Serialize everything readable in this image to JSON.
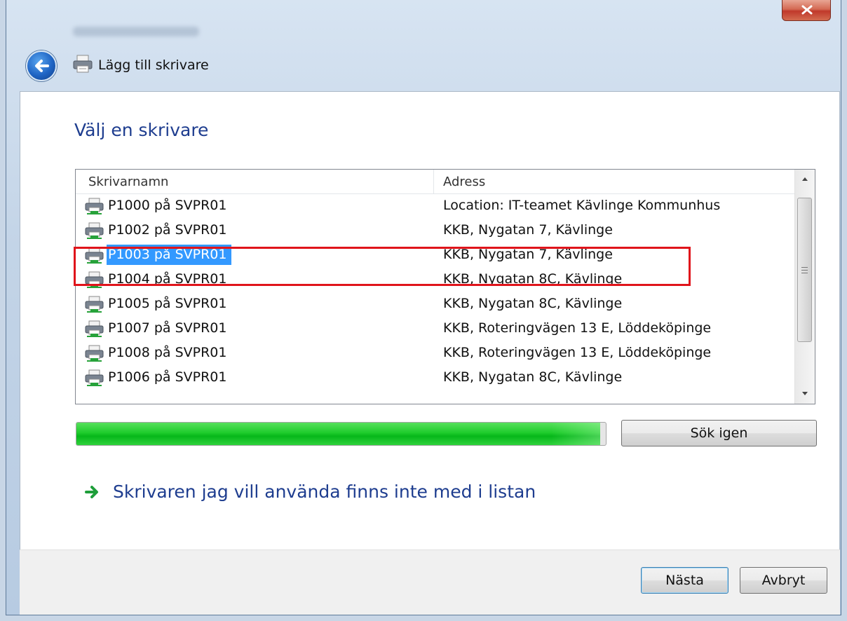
{
  "window": {
    "title": "Lägg till skrivare",
    "close_label": "x"
  },
  "content": {
    "heading": "Välj en skrivare"
  },
  "printer_list": {
    "column_name": "Skrivarnamn",
    "column_address": "Adress",
    "rows": [
      {
        "name": "P1000 på SVPR01",
        "address": "Location: IT-teamet Kävlinge Kommunhus",
        "selected": false
      },
      {
        "name": "P1002 på SVPR01",
        "address": "KKB, Nygatan 7, Kävlinge",
        "selected": false
      },
      {
        "name": "P1003 på SVPR01",
        "address": "KKB, Nygatan 7, Kävlinge",
        "selected": true
      },
      {
        "name": "P1004 på SVPR01",
        "address": "KKB, Nygatan 8C, Kävlinge",
        "selected": false
      },
      {
        "name": "P1005 på SVPR01",
        "address": "KKB, Nygatan 8C, Kävlinge",
        "selected": false
      },
      {
        "name": "P1007 på SVPR01",
        "address": "KKB, Roteringvägen 13 E, Löddeköpinge",
        "selected": false
      },
      {
        "name": "P1008 på SVPR01",
        "address": "KKB, Roteringvägen 13 E, Löddeköpinge",
        "selected": false
      },
      {
        "name": "P1006 på SVPR01",
        "address": "KKB, Nygatan 8C, Kävlinge",
        "selected": false
      }
    ],
    "icon": "network-printer-icon"
  },
  "search": {
    "progress_fraction": 0.99,
    "search_again_label": "Sök igen"
  },
  "not_listed_link": "Skrivaren jag vill använda finns inte med i listan",
  "footer": {
    "next_label": "Nästa",
    "cancel_label": "Avbryt"
  },
  "colors": {
    "heading": "#1e3d8f",
    "selection": "#3399ff",
    "progress": "#1fcc2c",
    "annotation": "#e0141b"
  }
}
